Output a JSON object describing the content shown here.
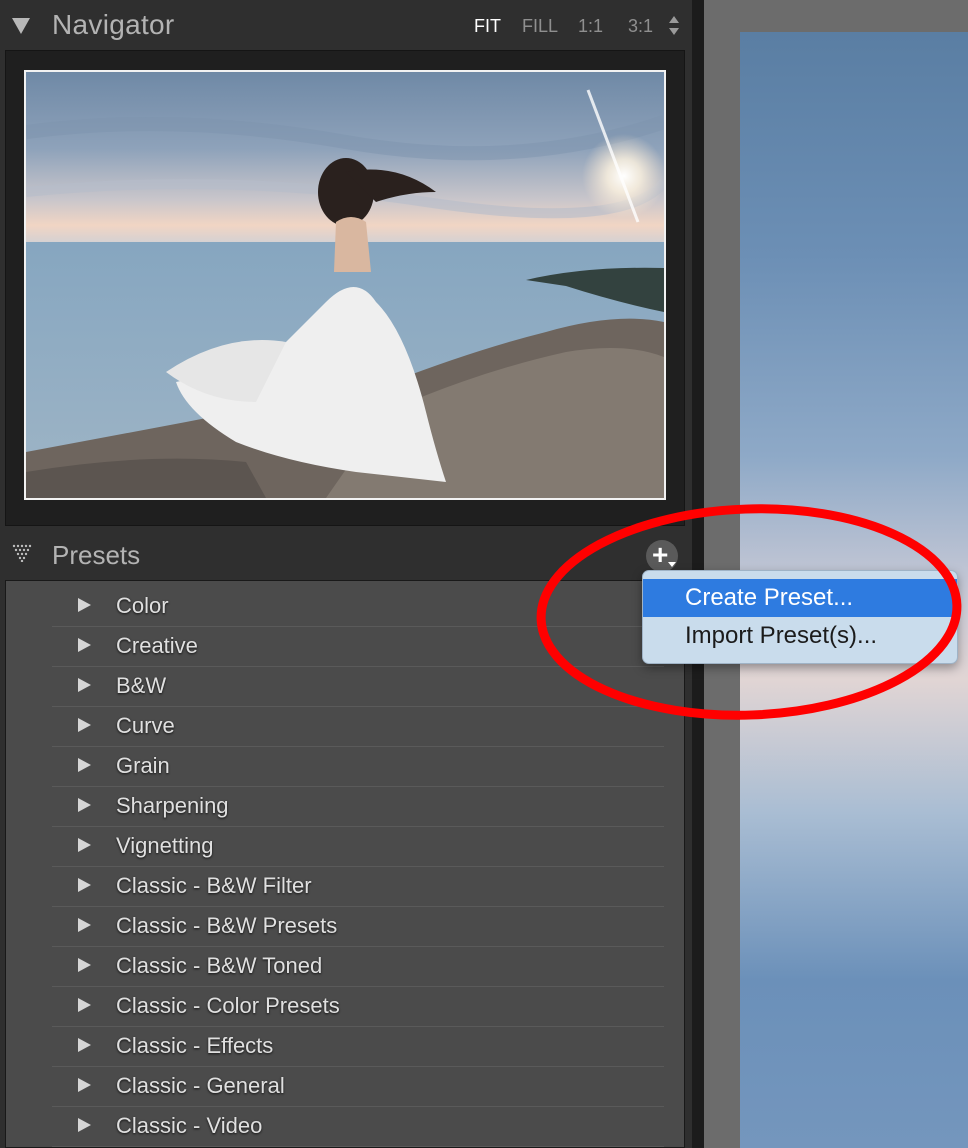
{
  "navigator": {
    "title": "Navigator",
    "zoom_options": [
      "FIT",
      "FILL",
      "1:1",
      "3:1"
    ],
    "active_zoom": "FIT"
  },
  "presets": {
    "title": "Presets",
    "items": [
      "Color",
      "Creative",
      "B&W",
      "Curve",
      "Grain",
      "Sharpening",
      "Vignetting",
      "Classic - B&W Filter",
      "Classic - B&W Presets",
      "Classic - B&W Toned",
      "Classic - Color Presets",
      "Classic - Effects",
      "Classic - General",
      "Classic - Video"
    ]
  },
  "menu": {
    "items": [
      "Create Preset...",
      "Import Preset(s)..."
    ],
    "highlighted": "Create Preset..."
  },
  "colors": {
    "menu_highlight": "#2e7be0",
    "annotation": "#ff0000",
    "panel_bg": "#2f2f2f",
    "list_bg": "#4b4b4b"
  }
}
